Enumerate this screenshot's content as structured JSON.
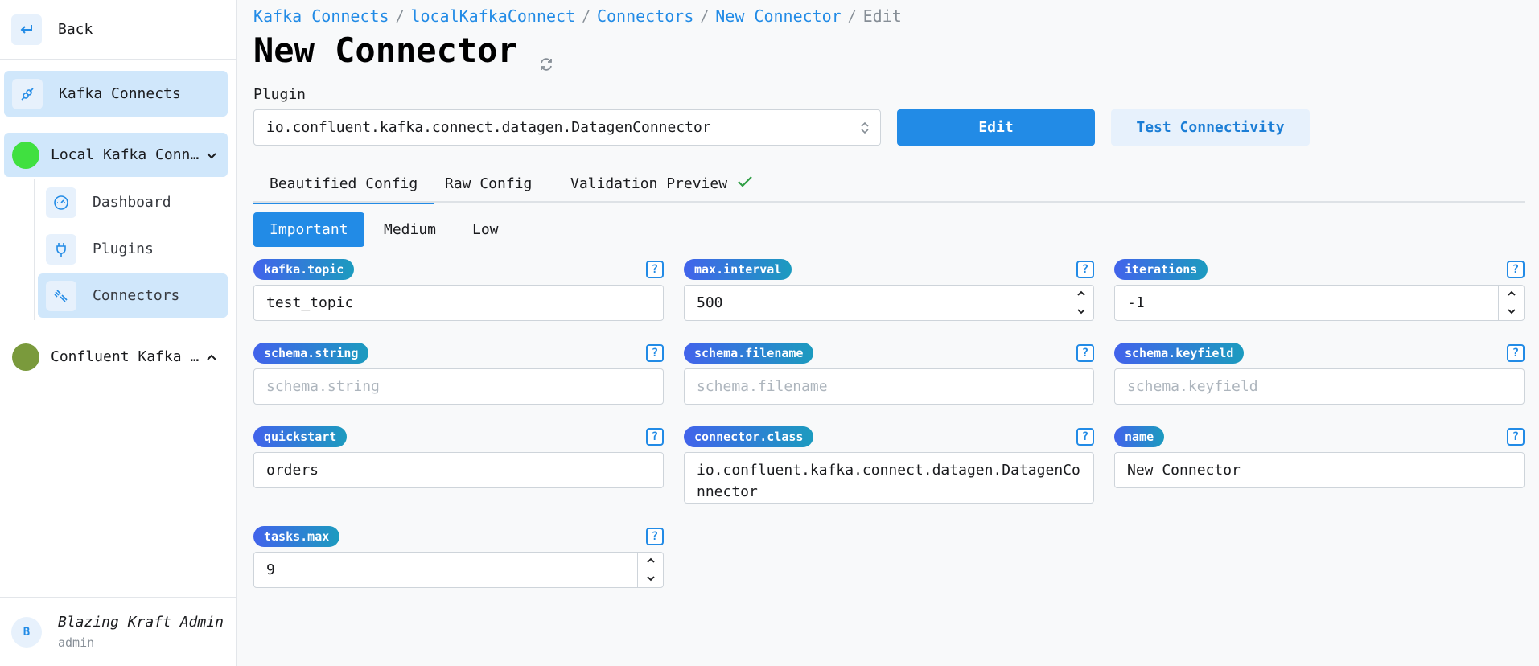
{
  "sidebar": {
    "back_label": "Back",
    "kafka_connects_label": "Kafka Connects",
    "connects": [
      {
        "label": "Local Kafka Connect",
        "color": "#40e040",
        "expanded": true
      },
      {
        "label": "Confluent Kafka Connect",
        "color": "#7a9a3c",
        "expanded": false
      }
    ],
    "sub_items": [
      {
        "label": "Dashboard",
        "icon": "dashboard-icon"
      },
      {
        "label": "Plugins",
        "icon": "plug-icon"
      },
      {
        "label": "Connectors",
        "icon": "connectors-icon"
      }
    ],
    "user": {
      "initial": "B",
      "name": "Blazing Kraft Admin",
      "role": "admin"
    }
  },
  "breadcrumb": {
    "items": [
      "Kafka Connects",
      "localKafkaConnect",
      "Connectors",
      "New Connector"
    ],
    "current": "Edit"
  },
  "page": {
    "title": "New Connector"
  },
  "plugin": {
    "label": "Plugin",
    "value": "io.confluent.kafka.connect.datagen.DatagenConnector"
  },
  "buttons": {
    "edit": "Edit",
    "test": "Test Connectivity"
  },
  "tabs": [
    "Beautified Config",
    "Raw Config",
    "Validation Preview"
  ],
  "importance": [
    "Important",
    "Medium",
    "Low"
  ],
  "fields": {
    "kafka_topic": {
      "name": "kafka.topic",
      "value": "test_topic"
    },
    "max_interval": {
      "name": "max.interval",
      "value": "500"
    },
    "iterations": {
      "name": "iterations",
      "value": "-1"
    },
    "schema_string": {
      "name": "schema.string",
      "placeholder": "schema.string"
    },
    "schema_filename": {
      "name": "schema.filename",
      "placeholder": "schema.filename"
    },
    "schema_keyfield": {
      "name": "schema.keyfield",
      "placeholder": "schema.keyfield"
    },
    "quickstart": {
      "name": "quickstart",
      "value": "orders"
    },
    "connector_class": {
      "name": "connector.class",
      "value": "io.confluent.kafka.connect.datagen.DatagenConnector"
    },
    "name": {
      "name": "name",
      "value": "New Connector"
    },
    "tasks_max": {
      "name": "tasks.max",
      "value": "9"
    }
  },
  "help_glyph": "?",
  "colors": {
    "accent": "#228be6",
    "active_bg": "#d0e7fb",
    "success": "#2f9e44"
  }
}
